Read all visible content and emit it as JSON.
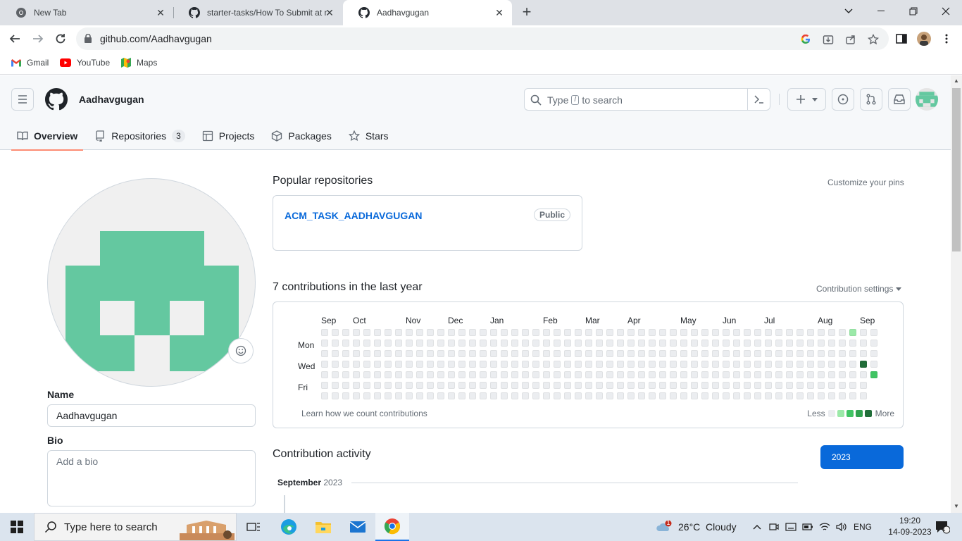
{
  "browser": {
    "tabs": [
      {
        "title": "New Tab",
        "active": false,
        "icon": "chrome-icon"
      },
      {
        "title": "starter-tasks/How To Submit at m",
        "active": false,
        "icon": "github-icon"
      },
      {
        "title": "Aadhavgugan",
        "active": true,
        "icon": "github-icon"
      }
    ],
    "url": "github.com/Aadhavgugan",
    "bookmarks": [
      {
        "label": "Gmail",
        "icon": "gmail-icon"
      },
      {
        "label": "YouTube",
        "icon": "youtube-icon"
      },
      {
        "label": "Maps",
        "icon": "maps-icon"
      }
    ]
  },
  "github": {
    "username": "Aadhavgugan",
    "search_placeholder_pre": "Type",
    "search_placeholder_key": "/",
    "search_placeholder_post": "to search",
    "tabs": [
      {
        "label": "Overview",
        "selected": true,
        "icon": "book-icon"
      },
      {
        "label": "Repositories",
        "selected": false,
        "icon": "repo-icon",
        "count": "3"
      },
      {
        "label": "Projects",
        "selected": false,
        "icon": "table-icon"
      },
      {
        "label": "Packages",
        "selected": false,
        "icon": "package-icon"
      },
      {
        "label": "Stars",
        "selected": false,
        "icon": "star-icon"
      }
    ],
    "sidebar": {
      "name_label": "Name",
      "name_value": "Aadhavgugan",
      "bio_label": "Bio",
      "bio_placeholder": "Add a bio"
    },
    "popular": {
      "title": "Popular repositories",
      "customize": "Customize your pins",
      "repos": [
        {
          "name": "ACM_TASK_AADHAVGUGAN",
          "visibility": "Public"
        }
      ]
    },
    "contributions": {
      "title": "7 contributions in the last year",
      "settings": "Contribution settings",
      "months": [
        "Sep",
        "Oct",
        "Nov",
        "Dec",
        "Jan",
        "Feb",
        "Mar",
        "Apr",
        "May",
        "Jun",
        "Jul",
        "Aug",
        "Sep"
      ],
      "days": [
        "Mon",
        "Wed",
        "Fri"
      ],
      "learn": "Learn how we count contributions",
      "less": "Less",
      "more": "More",
      "colors": [
        "#ebedf0",
        "#9be9a8",
        "#40c463",
        "#30a14e",
        "#216e39"
      ]
    },
    "activity": {
      "title": "Contribution activity",
      "year": "2023",
      "month": "September",
      "month_year": "2023"
    }
  },
  "taskbar": {
    "search_placeholder": "Type here to search",
    "weather": "26°C  Cloudy",
    "weather_badge": "1",
    "language": "ENG",
    "time": "19:20",
    "date": "14-09-2023",
    "notifications": "1"
  }
}
